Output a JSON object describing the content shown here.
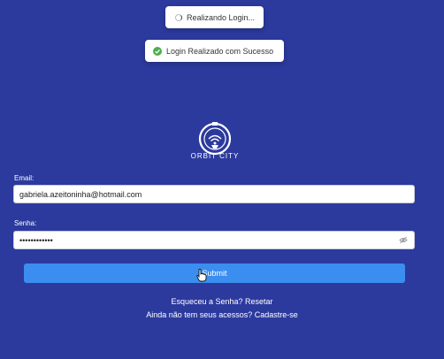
{
  "toasts": {
    "loading": {
      "text": "Realizando Login...",
      "icon": "spinner-icon"
    },
    "success": {
      "text": "Login Realizado com Sucesso",
      "icon": "check-circle-icon",
      "color": "#4caf50"
    }
  },
  "brand": {
    "name": "ORBIT CITY"
  },
  "form": {
    "email_label": "Email:",
    "email_value": "gabriela.azeitoninha@hotmail.com",
    "password_label": "Senha:",
    "password_value": "••••••••••••",
    "submit_label": "Submit"
  },
  "links": {
    "forgot_text": "Esqueceu a Senha? Resetar",
    "signup_text": "Ainda não tem seus acessos? Cadastre-se"
  },
  "colors": {
    "background": "#2c3a9e",
    "button": "#3b8eef"
  }
}
